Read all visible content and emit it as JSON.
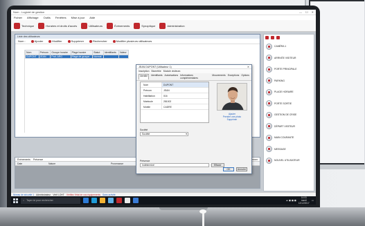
{
  "window": {
    "title": "Nom - Logiciel de gestion",
    "controls": [
      "—",
      "☐",
      "✕"
    ]
  },
  "menu": [
    "Fichier",
    "Affichage",
    "Outils",
    "Fenêtres",
    "Mise à jour",
    "Aide"
  ],
  "ribbon": [
    {
      "label": "Technique",
      "color": "#c0282d"
    },
    {
      "label": "Horaires et droits d'accès",
      "color": "#c0282d"
    },
    {
      "label": "Utilisateurs",
      "color": "#c0282d"
    },
    {
      "label": "Événements",
      "color": "#c0282d"
    },
    {
      "label": "Synoptique",
      "color": "#c0282d"
    },
    {
      "label": "Administration",
      "color": "#c0282d"
    }
  ],
  "mainwin": {
    "title": "Liste des utilisateurs",
    "search_label": "Nom :",
    "toolbar": [
      {
        "label": "Ajouter",
        "color": "#c0282d"
      },
      {
        "label": "Modifier",
        "color": "#c0282d"
      },
      {
        "label": "Supprimer",
        "color": "#c0282d"
      },
      {
        "label": "Rechercher",
        "color": "#c0282d"
      },
      {
        "label": "Modifier plusieurs utilisateurs",
        "color": "#c0282d"
      }
    ],
    "columns": [
      "Nom",
      "Prénom",
      "Groupe horaire",
      "Plage horaire",
      "Statut",
      "Identifiants",
      "Valeur"
    ],
    "rows": [
      [
        "DUPONT",
        "JEAN",
        "Prof. ARG",
        "Plage de groupe",
        "Normal",
        "",
        ""
      ]
    ]
  },
  "dialog": {
    "title": "JEAN DUPONT (Utilisateur 1)",
    "close": "✕",
    "tabs_top": [
      "Inscription",
      "Biométrie",
      "Module visiteurs"
    ],
    "tabs": [
      "Identité",
      "Identifiants",
      "Autorisations",
      "Informations complémentaires",
      "Mouvements",
      "Exceptions",
      "Options"
    ],
    "active_tab": "Identité",
    "fields": [
      {
        "label": "Nom",
        "value": "DUPONT"
      },
      {
        "label": "Prénom",
        "value": "JEAN"
      },
      {
        "label": "Habilitation",
        "value": "016"
      },
      {
        "label": "Matricule",
        "value": "281002"
      },
      {
        "label": "Mobile",
        "value": "CADRE"
      }
    ],
    "photo_links": [
      "Ajouter",
      "Prendre une photo",
      "Supprimer"
    ],
    "societe_label": "Société",
    "societe_value": "Société",
    "presence_label": "Présence",
    "presence_value": "Indéterminé",
    "presence_button": "Effacer",
    "ok": "OK",
    "cancel": "Annuler"
  },
  "rightpanel": {
    "items": [
      "CAMÉRA 1",
      "ARRIVÉE VISITEUR",
      "PORTE PRINCIPALE",
      "PARKING",
      "PLAGE HORAIRE",
      "PORTE SORTIE",
      "GESTION DE CRISE",
      "DÉPART VISITEUR",
      "MAIN COURANTE",
      "MESSAGE",
      "NOUVEL UTILISATEUR"
    ]
  },
  "events": {
    "tabs": [
      "Événements",
      "Présence"
    ],
    "right_label": "Fermer",
    "columns": [
      "Date",
      "Nature",
      "Provenance",
      "Identifiant",
      "Nom",
      "Prénom"
    ]
  },
  "status": {
    "items": [
      "Niveau de sécurité 1",
      "Administrateur",
      "Vérif LOHT",
      "Vérifiez l'état de vos équipements",
      "Sans activité"
    ]
  },
  "taskbar": {
    "search_placeholder": "Taper ici pour rechercher",
    "time": "14:03",
    "day": "mardi",
    "date": "12/12/2017",
    "apps": [
      "#2d7bd6",
      "#1f9bd7",
      "#f2b233",
      "#5fb0e6",
      "#c0282d",
      "#e9e9e9",
      "#3a7bd5"
    ]
  }
}
